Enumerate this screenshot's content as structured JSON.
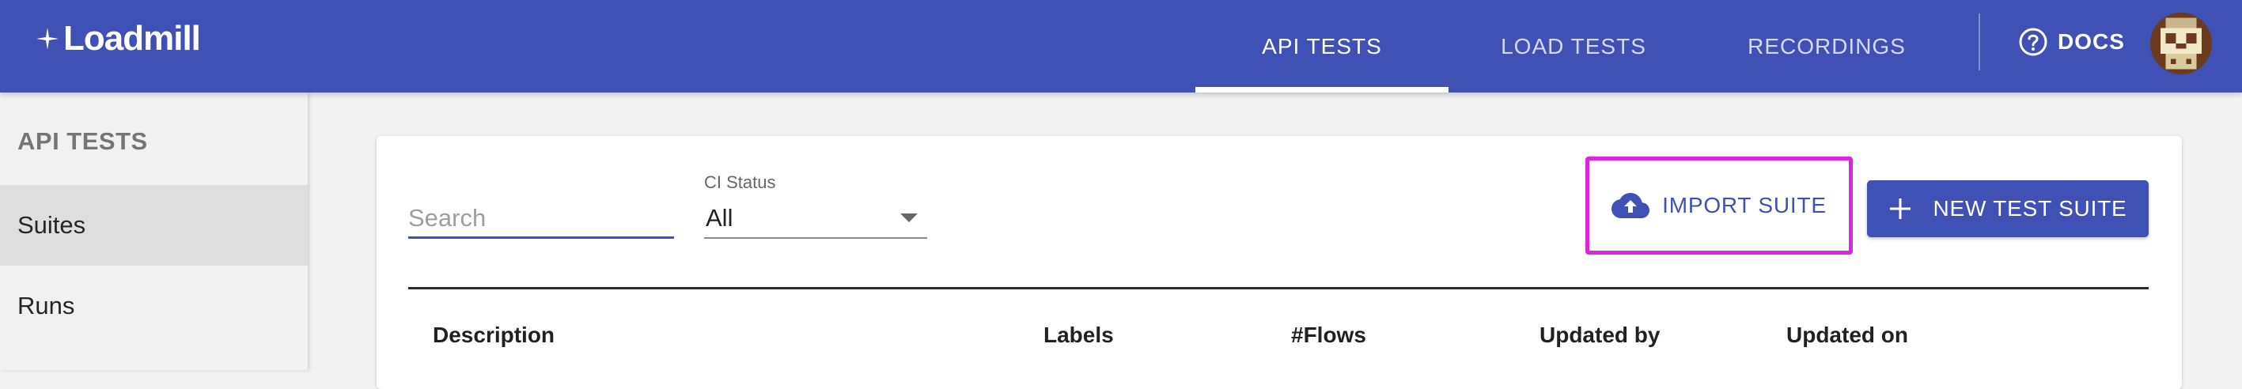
{
  "app": {
    "name": "Loadmill"
  },
  "nav": {
    "tabs": [
      {
        "label": "API TESTS",
        "active": true
      },
      {
        "label": "LOAD TESTS",
        "active": false
      },
      {
        "label": "RECORDINGS",
        "active": false
      }
    ],
    "docs_label": "DOCS"
  },
  "sidebar": {
    "heading": "API TESTS",
    "items": [
      {
        "label": "Suites",
        "selected": true
      },
      {
        "label": "Runs",
        "selected": false
      }
    ]
  },
  "filters": {
    "search_placeholder": "Search",
    "search_value": "",
    "ci_status_label": "CI Status",
    "ci_status_value": "All"
  },
  "actions": {
    "import_label": "IMPORT SUITE",
    "new_suite_label": "NEW TEST SUITE"
  },
  "table": {
    "columns": [
      "Description",
      "Labels",
      "#Flows",
      "Updated by",
      "Updated on"
    ]
  },
  "icons": {
    "logo": "loadmill-logo-icon",
    "help": "help-circle-icon",
    "import": "cloud-upload-icon",
    "new": "plus-icon",
    "select": "chevron-down-icon"
  },
  "colors": {
    "primary": "#3f51b5",
    "highlight_outline": "#dd24e0",
    "background": "#f2f2f2",
    "sidebar_selected": "#dedede"
  }
}
